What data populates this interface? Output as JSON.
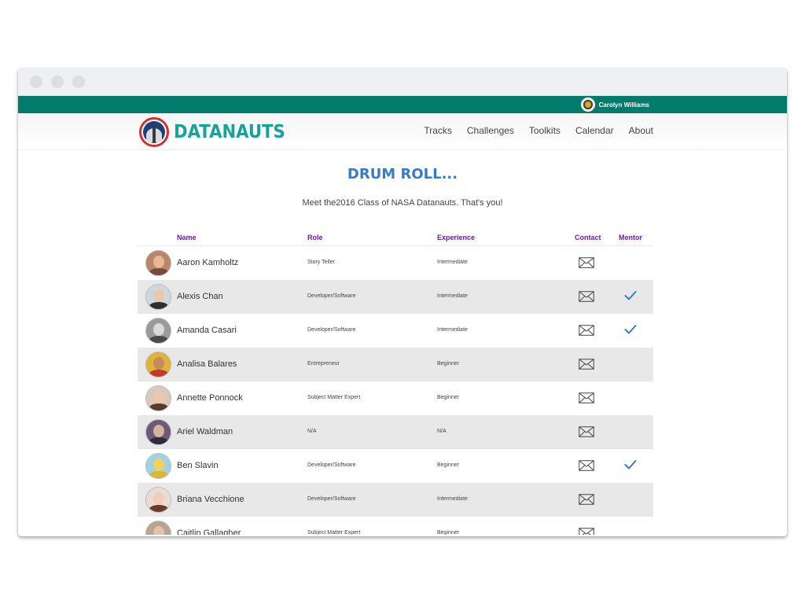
{
  "user": {
    "name": "Carolyn Williams"
  },
  "brand": {
    "name": "DATANAUTS"
  },
  "nav": [
    "Tracks",
    "Challenges",
    "Toolkits",
    "Calendar",
    "About"
  ],
  "headline": "DRUM ROLL...",
  "subtitle": "Meet the2016 Class of NASA Datanauts. That's you!",
  "columns": {
    "name": "Name",
    "role": "Role",
    "experience": "Experience",
    "contact": "Contact",
    "mentor": "Mentor"
  },
  "colors": {
    "teal_bar": "#007b6c",
    "brand": "#15a39b",
    "headline": "#3a7bc8",
    "header_text": "#6a1bb0",
    "check": "#3a7bc8"
  },
  "members": [
    {
      "name": "Aaron Kamholtz",
      "role": "Story Teller",
      "experience": "Intermediate",
      "mentor": false,
      "avatar_bg": "#b8876a",
      "skin": "#e7b895",
      "shirt": "#7a4a3a"
    },
    {
      "name": "Alexis Chan",
      "role": "Developer/Software",
      "experience": "Intermediate",
      "mentor": true,
      "avatar_bg": "#cfd7de",
      "skin": "#e9c9ab",
      "shirt": "#2e2e2e"
    },
    {
      "name": "Amanda Casari",
      "role": "Developer/Software",
      "experience": "Intermediate",
      "mentor": true,
      "avatar_bg": "#9a9a9a",
      "skin": "#d9d9d9",
      "shirt": "#4a4a4a"
    },
    {
      "name": "Analisa Balares",
      "role": "Entrepreneur",
      "experience": "Beginner",
      "mentor": false,
      "avatar_bg": "#e0b23a",
      "skin": "#c68a5c",
      "shirt": "#c0392b"
    },
    {
      "name": "Annette Ponnock",
      "role": "Subject Matter Expert",
      "experience": "Beginner",
      "mentor": false,
      "avatar_bg": "#d8c9bf",
      "skin": "#eec7aa",
      "shirt": "#5b3a2c"
    },
    {
      "name": "Ariel Waldman",
      "role": "N/A",
      "experience": "N/A",
      "mentor": false,
      "avatar_bg": "#6b5a7a",
      "skin": "#d7b39b",
      "shirt": "#2f2b3a"
    },
    {
      "name": "Ben Slavin",
      "role": "Developer/Software",
      "experience": "Beginner",
      "mentor": true,
      "avatar_bg": "#9fd3e2",
      "skin": "#f2d25a",
      "shirt": "#e0b534"
    },
    {
      "name": "Briana Vecchione",
      "role": "Developer/Software",
      "experience": "Intermediate",
      "mentor": false,
      "avatar_bg": "#e8ddd4",
      "skin": "#f0cfb6",
      "shirt": "#6b3b2a"
    },
    {
      "name": "Caitlin Gallagher",
      "role": "Subject Matter Expert",
      "experience": "Beginner",
      "mentor": false,
      "avatar_bg": "#b9a590",
      "skin": "#e3c2a6",
      "shirt": "#4a3a2a"
    }
  ]
}
